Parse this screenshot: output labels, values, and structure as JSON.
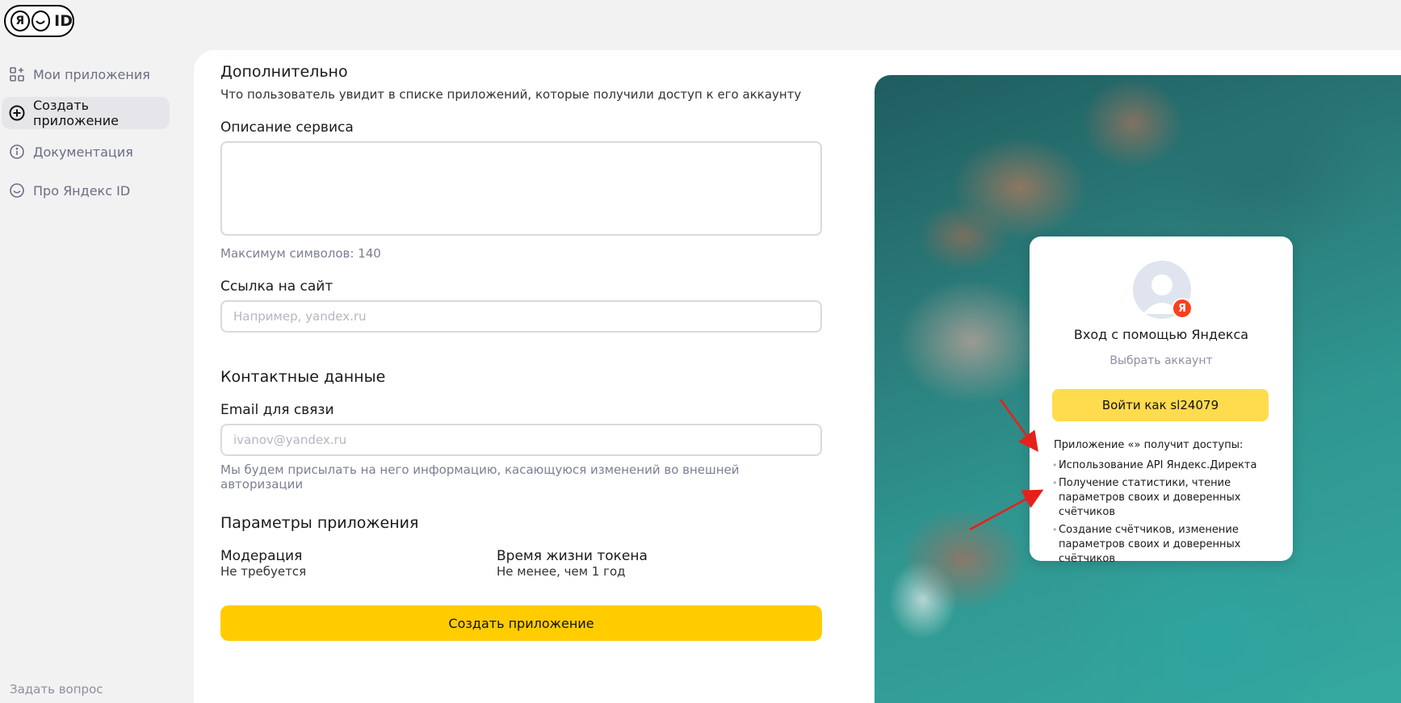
{
  "logo": {
    "ya": "Я",
    "id": "ID"
  },
  "sidebar": {
    "items": [
      {
        "label": "Мои приложения",
        "icon": "apps-grid-icon"
      },
      {
        "label": "Создать приложение",
        "icon": "plus-circle-icon",
        "active": true
      },
      {
        "label": "Документация",
        "icon": "info-icon"
      },
      {
        "label": "Про Яндекс ID",
        "icon": "yandex-id-icon"
      }
    ],
    "ask": "Задать вопрос"
  },
  "form": {
    "additional": {
      "title": "Дополнительно",
      "subtitle": "Что пользователь увидит в списке приложений, которые получили доступ к его аккаунту"
    },
    "description": {
      "label": "Описание сервиса",
      "value": "",
      "hint": "Максимум символов: 140"
    },
    "site": {
      "label": "Ссылка на сайт",
      "placeholder": "Например, yandex.ru"
    },
    "contacts": {
      "title": "Контактные данные",
      "email_label": "Email для связи",
      "email_placeholder": "ivanov@yandex.ru",
      "email_hint": "Мы будем присылать на него информацию, касающуюся изменений во внешней авторизации"
    },
    "params": {
      "title": "Параметры приложения",
      "moderation_label": "Модерация",
      "moderation_value": "Не требуется",
      "token_label": "Время жизни токена",
      "token_value": "Не менее, чем 1 год"
    },
    "submit_label": "Создать приложение"
  },
  "preview": {
    "badge": "Я",
    "title": "Вход с помощью Яндекса",
    "choose_account": "Выбрать аккаунт",
    "login_button": "Войти как sl24079",
    "access_title": "Приложение «» получит доступы:",
    "permissions": [
      "Использование API Яндекс.Директа",
      "Получение статистики, чтение параметров своих и доверенных счётчиков",
      "Создание счётчиков, изменение параметров своих и доверенных счётчиков"
    ]
  },
  "colors": {
    "accent": "#ffcc00",
    "login_button": "#ffdb4d",
    "annotation_arrow": "#e8201a",
    "ya_badge": "#fc3f1d"
  }
}
